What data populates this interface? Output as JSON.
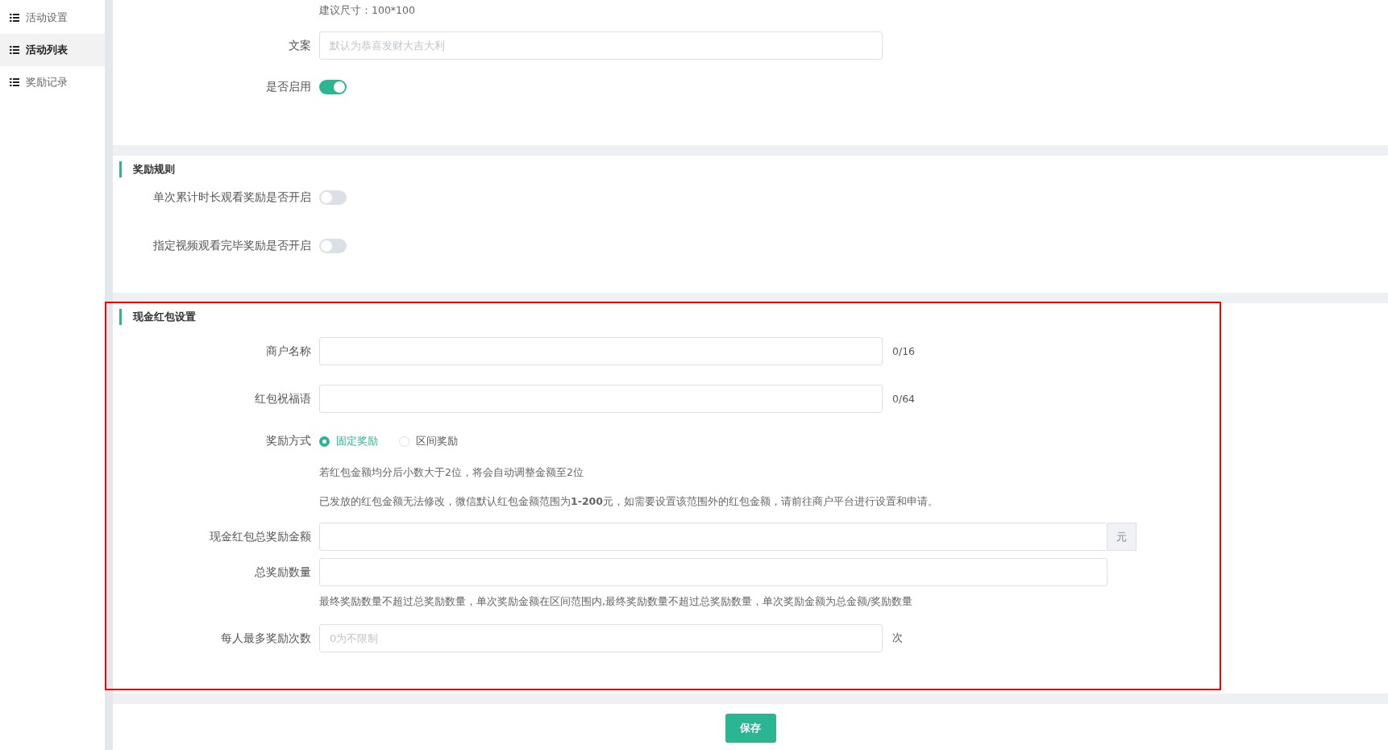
{
  "sidebar": {
    "items": [
      {
        "label": "活动设置",
        "selected": false
      },
      {
        "label": "活动列表",
        "selected": true
      },
      {
        "label": "奖励记录",
        "selected": false
      }
    ]
  },
  "sections": [
    {
      "rows": [
        {
          "kind": "hint",
          "text": "建议尺寸：100*100"
        },
        {
          "kind": "input",
          "label": "文案",
          "placeholder": "默认为恭喜发财大吉大利"
        },
        {
          "kind": "switch",
          "label": "是否启用",
          "on": true
        }
      ]
    },
    {
      "title": "奖励规则",
      "rows": [
        {
          "kind": "switch",
          "label": "单次累计时长观看奖励是否开启",
          "on": false
        },
        {
          "kind": "switch",
          "label": "指定视频观看完毕奖励是否开启",
          "on": false
        }
      ]
    },
    {
      "title": "现金红包设置",
      "highlighted": true,
      "rows": [
        {
          "kind": "input",
          "label": "商户名称",
          "counter": "0/16"
        },
        {
          "kind": "input",
          "label": "红包祝福语",
          "counter": "0/64"
        },
        {
          "kind": "radio",
          "label": "奖励方式",
          "options": [
            {
              "label": "固定奖励",
              "selected": true
            },
            {
              "label": "区间奖励",
              "selected": false
            }
          ]
        },
        {
          "kind": "hint",
          "text": "若红包金额均分后小数大于2位，将会自动调整金额至2位"
        },
        {
          "kind": "hint",
          "text": "已发放的红包金额无法修改，微信默认红包金额范围为**1-200**元，如需要设置该范围外的红包金额，请前往商户平台进行设置和申请。"
        },
        {
          "kind": "input",
          "label": "现金红包总奖励金额",
          "wide": true,
          "addon": "元"
        },
        {
          "kind": "input",
          "label": "总奖励数量",
          "wide": true
        },
        {
          "kind": "hint",
          "text": "最终奖励数量不超过总奖励数量，单次奖励金额在区间范围内,最终奖励数量不超过总奖励数量，单次奖励金额为总金额/奖励数量",
          "tight": true
        },
        {
          "kind": "input",
          "label": "每人最多奖励次数",
          "placeholder": "0为不限制",
          "suffix": "次"
        }
      ]
    }
  ],
  "footer": {
    "save_button": "保存"
  }
}
